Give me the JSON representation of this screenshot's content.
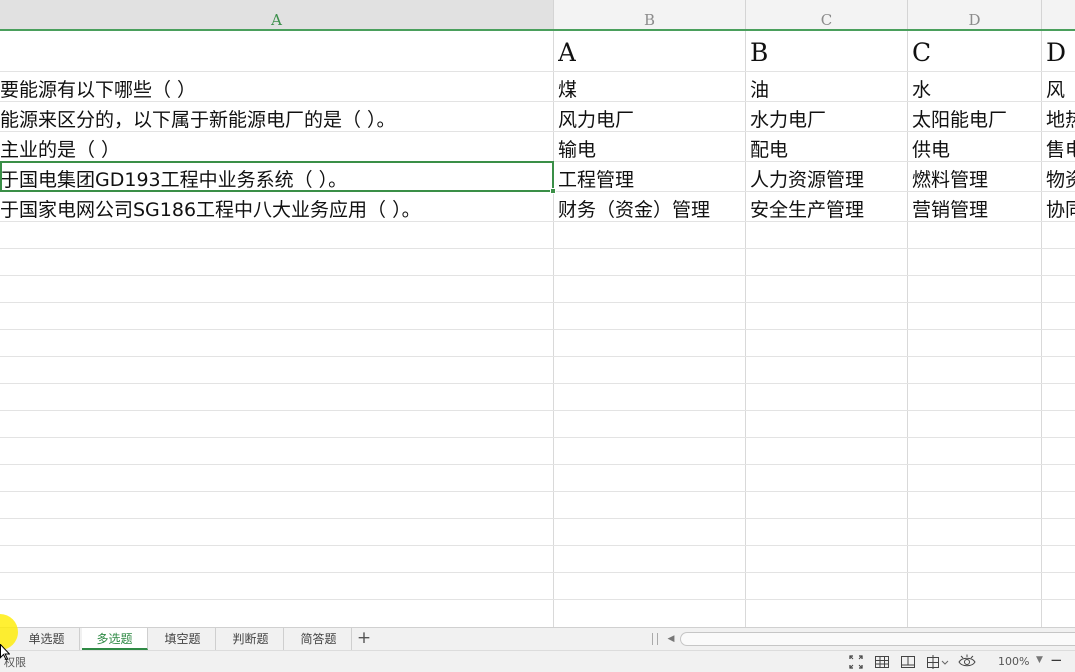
{
  "columns": [
    "A",
    "B",
    "C",
    "D",
    ""
  ],
  "header_row": {
    "b": "A",
    "c": "B",
    "d": "C",
    "e": "D"
  },
  "rows": [
    {
      "a": "要能源有以下哪些（   ）",
      "b": "煤",
      "c": "油",
      "d": "水",
      "e": "风"
    },
    {
      "a": "能源来区分的，以下属于新能源电厂的是（  ）。",
      "b": "风力电厂",
      "c": "水力电厂",
      "d": "太阳能电厂",
      "e": "地热"
    },
    {
      "a": "主业的是（   ）",
      "b": "输电",
      "c": "配电",
      "d": "供电",
      "e": "售电"
    },
    {
      "a": "于国电集团GD193工程中业务系统（   ）。",
      "b": "工程管理",
      "c": "人力资源管理",
      "d": "燃料管理",
      "e": "物资"
    },
    {
      "a": "于国家电网公司SG186工程中八大业务应用（  ）。",
      "b": "财务（资金）管理",
      "c": "安全生产管理",
      "d": "营销管理",
      "e": "协同"
    }
  ],
  "sheet_tabs": [
    "单选题",
    "多选题",
    "填空题",
    "判断题",
    "简答题"
  ],
  "active_tab": "多选题",
  "add_sheet_label": "+",
  "status": {
    "text": "权限",
    "zoom": "100%",
    "zoom_out": "−"
  },
  "icons": [
    "fullscreen-icon",
    "normal-view-icon",
    "page-layout-icon",
    "page-break-view-icon",
    "eye-protection-icon"
  ],
  "colors": {
    "accent": "#3a8f47",
    "grid": "#e3e3e3",
    "header_bg": "#f3f3f3",
    "highlight": "#ffec00"
  }
}
